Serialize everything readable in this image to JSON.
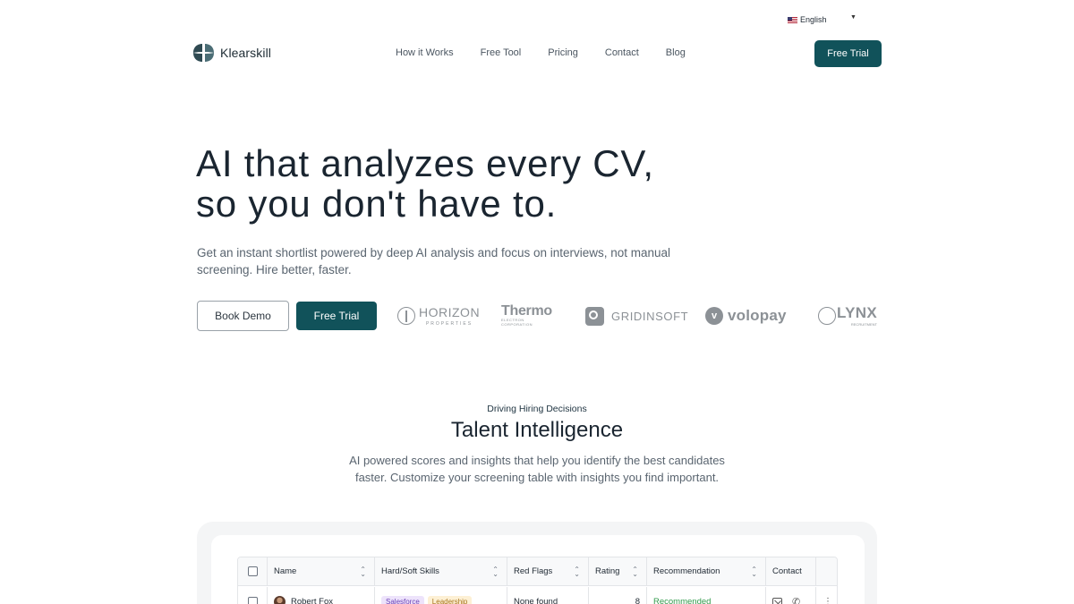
{
  "language": {
    "label": "English",
    "flag_icon": "us-flag-icon"
  },
  "header": {
    "brand": "Klearskill",
    "nav": [
      "How it Works",
      "Free Tool",
      "Pricing",
      "Contact",
      "Blog"
    ],
    "cta": "Free Trial"
  },
  "hero": {
    "title_line1": "AI that analyzes every CV,",
    "title_line2": "so you don't have to.",
    "subtitle": "Get an instant shortlist powered by deep AI analysis and focus on interviews, not manual screening. Hire better, faster.",
    "btn_demo": "Book Demo",
    "btn_trial": "Free Trial"
  },
  "client_logos": {
    "horizon": {
      "name": "HORIZON",
      "sub": "PROPERTIES"
    },
    "thermo": {
      "name": "Thermo",
      "sub": "ELECTRON CORPORATION"
    },
    "gridinsoft": {
      "name": "GRIDINSOFT"
    },
    "volopay": {
      "name": "volopay"
    },
    "lynx": {
      "name": "LYNX",
      "sub": "RECRUITMENT"
    }
  },
  "section": {
    "eyebrow": "Driving Hiring Decisions",
    "title": "Talent Intelligence",
    "subtitle": "AI powered scores and insights that help you identify the best candidates faster. Customize your screening table with insights you find important."
  },
  "table": {
    "columns": [
      "Name",
      "Hard/Soft Skills",
      "Red Flags",
      "Rating",
      "Recommendation",
      "Contact"
    ],
    "rows": [
      {
        "name": "Robert Fox",
        "skills": [
          "Salesforce",
          "Leadership"
        ],
        "red_flags": "None found",
        "rating": "8",
        "recommendation": "Recommended"
      }
    ]
  },
  "colors": {
    "primary": "#11525a",
    "recommended": "#2f9a4a"
  }
}
